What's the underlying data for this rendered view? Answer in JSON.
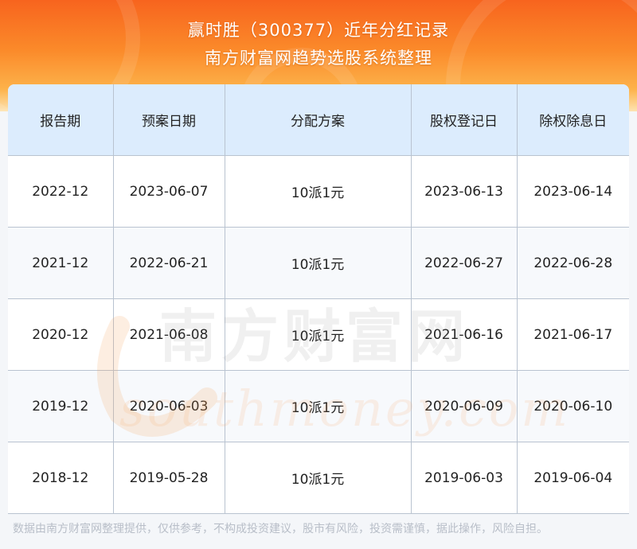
{
  "header": {
    "title": "赢时胜（300377）近年分红记录",
    "subtitle": "南方财富网趋势选股系统整理"
  },
  "table": {
    "columns": [
      "报告期",
      "预案日期",
      "分配方案",
      "股权登记日",
      "除权除息日"
    ],
    "rows": [
      [
        "2022-12",
        "2023-06-07",
        "10派1元",
        "2023-06-13",
        "2023-06-14"
      ],
      [
        "2021-12",
        "2022-06-21",
        "10派1元",
        "2022-06-27",
        "2022-06-28"
      ],
      [
        "2020-12",
        "2021-06-08",
        "10派1元",
        "2021-06-16",
        "2021-06-17"
      ],
      [
        "2019-12",
        "2020-06-03",
        "10派1元",
        "2020-06-09",
        "2020-06-10"
      ],
      [
        "2018-12",
        "2019-05-28",
        "10派1元",
        "2019-06-03",
        "2019-06-04"
      ]
    ]
  },
  "watermark": {
    "cn": "南方财富网",
    "en": "southmoney.com"
  },
  "footer": {
    "disclaimer": "数据由南方财富网整理提供，仅供参考，不构成投资建议，股市有风险，投资需谨慎，据此操作，风险自担。"
  },
  "colors": {
    "banner_top": "#f7641e",
    "banner_bottom": "#fdb24a",
    "header_row": "#dcecfd",
    "grid": "#b9c3d0"
  }
}
